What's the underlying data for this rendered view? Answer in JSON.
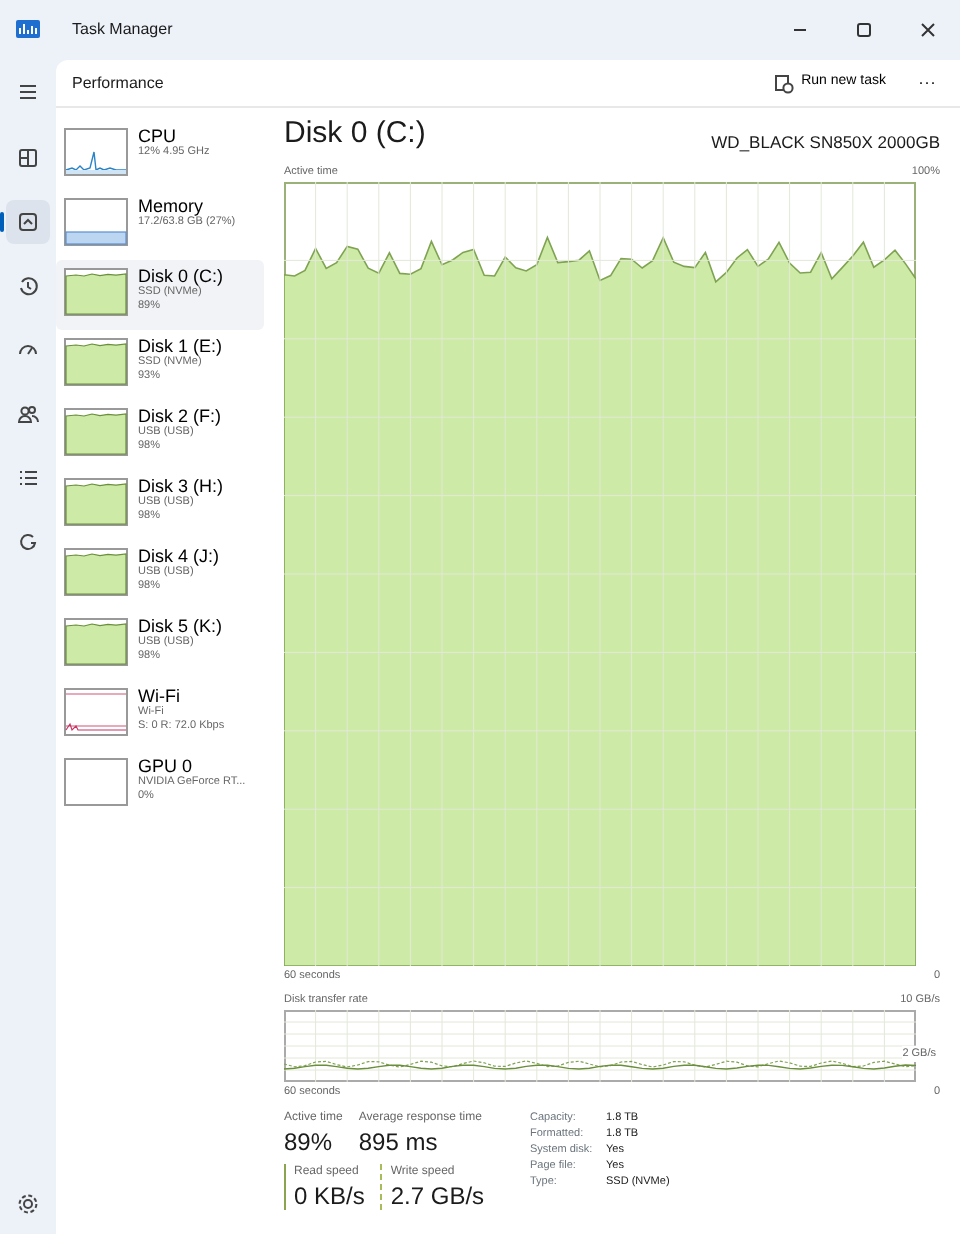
{
  "window": {
    "title": "Task Manager"
  },
  "nav": [
    {
      "selected": false
    },
    {
      "selected": false
    },
    {
      "selected": true
    },
    {
      "selected": false
    },
    {
      "selected": false
    },
    {
      "selected": false
    },
    {
      "selected": false
    },
    {
      "selected": false
    }
  ],
  "header": {
    "title": "Performance",
    "run_task": "Run new task",
    "more": "···"
  },
  "devices": [
    {
      "kind": "cpu",
      "name": "CPU",
      "lines": [
        "12%  4.95 GHz"
      ],
      "selected": false
    },
    {
      "kind": "memory",
      "name": "Memory",
      "lines": [
        "17.2/63.8 GB (27%)"
      ],
      "selected": false
    },
    {
      "kind": "disk",
      "name": "Disk 0 (C:)",
      "lines": [
        "SSD (NVMe)",
        "89%"
      ],
      "selected": true
    },
    {
      "kind": "disk",
      "name": "Disk 1 (E:)",
      "lines": [
        "SSD (NVMe)",
        "93%"
      ],
      "selected": false
    },
    {
      "kind": "disk",
      "name": "Disk 2 (F:)",
      "lines": [
        "USB (USB)",
        "98%"
      ],
      "selected": false
    },
    {
      "kind": "disk",
      "name": "Disk 3 (H:)",
      "lines": [
        "USB (USB)",
        "98%"
      ],
      "selected": false
    },
    {
      "kind": "disk",
      "name": "Disk 4 (J:)",
      "lines": [
        "USB (USB)",
        "98%"
      ],
      "selected": false
    },
    {
      "kind": "disk",
      "name": "Disk 5 (K:)",
      "lines": [
        "USB (USB)",
        "98%"
      ],
      "selected": false
    },
    {
      "kind": "network",
      "name": "Wi-Fi",
      "lines": [
        "Wi-Fi",
        "S: 0 R: 72.0 Kbps"
      ],
      "selected": false
    },
    {
      "kind": "gpu",
      "name": "GPU 0",
      "lines": [
        "NVIDIA GeForce RT...",
        "0%"
      ],
      "selected": false
    }
  ],
  "detail": {
    "title": "Disk 0 (C:)",
    "model": "WD_BLACK SN850X 2000GB",
    "active_chart": {
      "label": "Active time",
      "max": "100%",
      "time": "60 seconds",
      "min": "0"
    },
    "transfer_chart": {
      "label": "Disk transfer rate",
      "max": "10 GB/s",
      "mid": "2 GB/s",
      "time": "60 seconds",
      "min": "0"
    },
    "stats": [
      {
        "label": "Active time",
        "value": "89%"
      },
      {
        "label": "Average response time",
        "value": "895 ms"
      }
    ],
    "speeds": [
      {
        "kind": "read",
        "label": "Read speed",
        "value": "0 KB/s"
      },
      {
        "kind": "write",
        "label": "Write speed",
        "value": "2.7 GB/s"
      }
    ],
    "properties": [
      {
        "key": "Capacity:",
        "value": "1.8 TB"
      },
      {
        "key": "Formatted:",
        "value": "1.8 TB"
      },
      {
        "key": "System disk:",
        "value": "Yes"
      },
      {
        "key": "Page file:",
        "value": "Yes"
      },
      {
        "key": "Type:",
        "value": "SSD (NVMe)"
      }
    ]
  }
}
